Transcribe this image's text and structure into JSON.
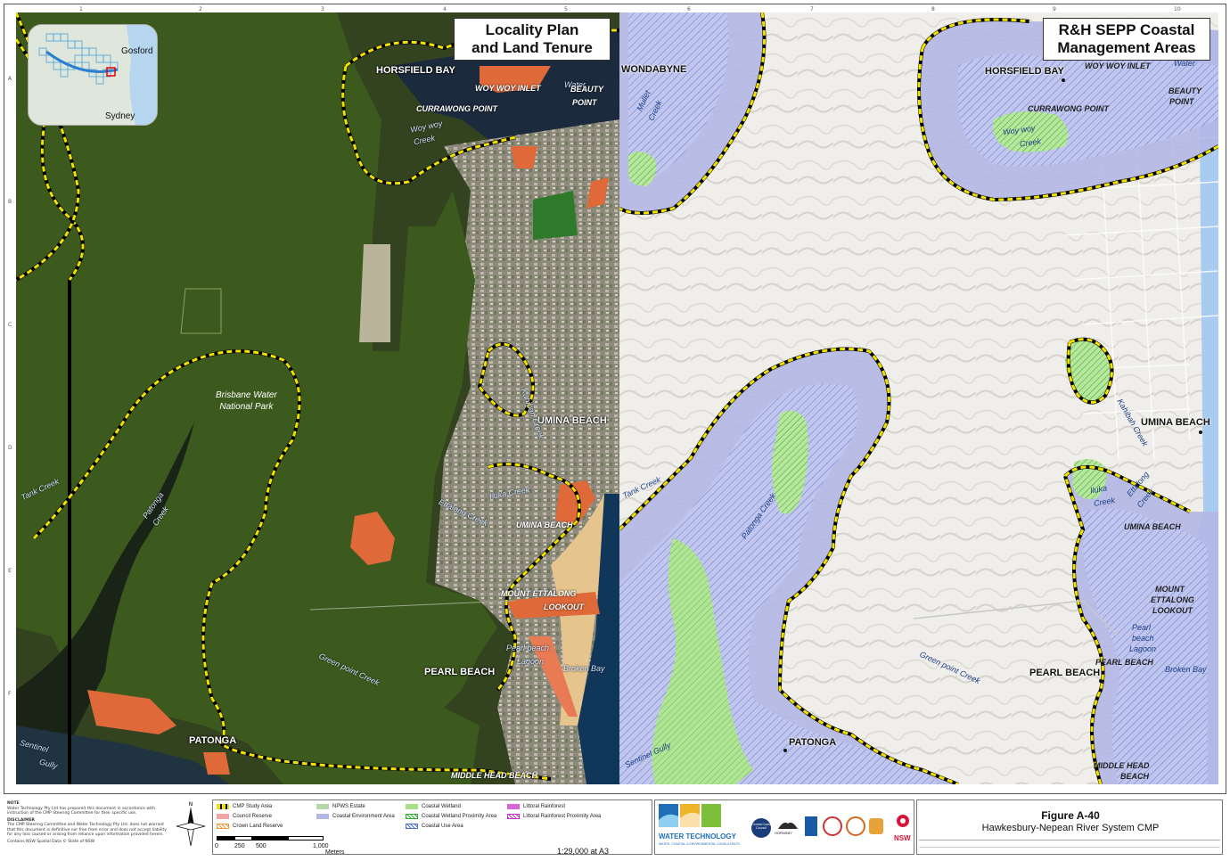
{
  "left_panel": {
    "title_line1": "Locality Plan",
    "title_line2": "and Land Tenure",
    "labels": {
      "horsfield_bay": "HORSFIELD BAY",
      "woy_woy_inlet": "WOY WOY INLET",
      "water": "Water",
      "beauty_point_1": "BEAUTY",
      "beauty_point_2": "POINT",
      "currawong_point": "CURRAWONG POINT",
      "woy_woy_creek_1": "Woy woy",
      "woy_woy_creek_2": "Creek",
      "brisbane_water_1": "Brisbane Water",
      "brisbane_water_2": "National Park",
      "umina_beach_1": "UMINA BEACH",
      "umina_beach_2": "UMINA BEACH",
      "kahibah_creek": "Kahibah Creek",
      "iluka_creek": "Iluka Creek",
      "ettalong_creek": "Ettalong Creek",
      "tank_creek": "Tank Creek",
      "patonga_creek_1": "Patonga",
      "patonga_creek_2": "Creek",
      "mount_ettalong_1": "MOUNT ETTALONG",
      "mount_ettalong_2": "LOOKOUT",
      "pearl_beach": "PEARL BEACH",
      "pearl_beach_lagoon_1": "Pearl beach",
      "pearl_beach_lagoon_2": "Lagoon",
      "broken_bay": "Broken Bay",
      "green_point_creek": "Green point Creek",
      "patonga": "PATONGA",
      "sentinel_gully_1": "Sentinel",
      "sentinel_gully_2": "Gully",
      "middle_head_beach": "MIDDLE HEAD BEACH",
      "wondabyne": "WONDABYNE"
    },
    "inset": {
      "gosford": "Gosford",
      "sydney": "Sydney"
    }
  },
  "right_panel": {
    "title_line1": "R&H SEPP Coastal",
    "title_line2": "Management Areas",
    "labels": {
      "horsfield_bay": "HORSFIELD BAY",
      "woy_woy_inlet": "WOY WOY INLET",
      "water": "Water",
      "beauty_1": "BEAUTY",
      "beauty_2": "POINT",
      "currawong_point": "CURRAWONG POINT",
      "woy_woy_1": "Woy woy",
      "woy_woy_2": "Creek",
      "mullet_1": "Mullet",
      "mullet_2": "Creek",
      "umina_beach": "UMINA BEACH",
      "umina_beach_2": "UMINA BEACH",
      "kahibah_creek": "Kahibah Creek",
      "iluka_1": "Iluka",
      "iluka_2": "Creek",
      "ettalong_1": "Ettalong",
      "ettalong_2": "Creek",
      "tank_creek": "Tank Creek",
      "patonga_creek": "Patonga Creek",
      "mount_1": "MOUNT",
      "mount_2": "ETTALONG",
      "mount_3": "LOOKOUT",
      "pearl_beach": "PEARL BEACH",
      "pearl_beach_2": "PEARL BEACH",
      "pearl_lagoon_1": "Pearl",
      "pearl_lagoon_2": "beach",
      "pearl_lagoon_3": "Lagoon",
      "broken_bay": "Broken Bay",
      "green_point_creek": "Green point Creek",
      "patonga": "PATONGA",
      "sentinel_gully": "Sentinel Gully",
      "middle_head_1": "MIDDLE HEAD",
      "middle_head_2": "BEACH"
    }
  },
  "footer": {
    "note_heading": "NOTE",
    "note_text": "Water Technology Pty Ltd has prepared this document in accordance with instruction of the CMP Steering Committee for their specific use.",
    "disclaimer_heading": "DISCLAIMER",
    "disclaimer_text": "The CMP Steering Committee and Water Technology Pty Ltd. does not warrant that this document is definitive nor free from error and does not accept liability for any loss caused or arising from reliance upon information provided herein.",
    "contains_text": "Contains NSW Spatial Data © State of NSW",
    "legend": [
      {
        "label": "CMP Study Area",
        "color": "#f2e200",
        "style": "dash"
      },
      {
        "label": "Council Reserve",
        "color": "#f2a3a3",
        "style": "fill"
      },
      {
        "label": "Crown Land Reserve",
        "color": "#e89a3a",
        "style": "hatch"
      },
      {
        "label": "NPWS Estate",
        "color": "#b6d7a8",
        "style": "fill"
      },
      {
        "label": "Coastal Environment Area",
        "color": "#b3b7e6",
        "style": "fill"
      },
      {
        "label": "Coastal Wetland",
        "color": "#a8e08a",
        "style": "fill"
      },
      {
        "label": "Coastal Wetland Proximity Area",
        "color": "#2ea82e",
        "style": "hatch"
      },
      {
        "label": "Coastal Use Area",
        "color": "#4a6fd6",
        "style": "hatch"
      },
      {
        "label": "Littoral Rainforest",
        "color": "#d966d9",
        "style": "fill"
      },
      {
        "label": "Littoral Rainforest Proximity Area",
        "color": "#c22ec2",
        "style": "hatch"
      }
    ],
    "scale_ticks": [
      "0",
      "250",
      "500",
      "1,000"
    ],
    "scale_unit": "Meters",
    "scale_ratio": "1:29,000 at A3",
    "logo_text_1": "WATER TECHNOLOGY",
    "logo_text_2": "WATER, COASTAL & ENVIRONMENTAL CONSULTANTS",
    "figure_title": "Figure A-40",
    "figure_subtitle": "Hawkesbury-Nepean River System CMP",
    "central_coast": "Central Coast Council",
    "hornsby": "HORNSBY",
    "nsw": "NSW"
  },
  "ruler": {
    "top": [
      "1",
      "2",
      "3",
      "4",
      "5",
      "6",
      "7",
      "8",
      "9",
      "10"
    ],
    "side": [
      "A",
      "B",
      "C",
      "D",
      "E",
      "F"
    ]
  },
  "colors": {
    "npws_green": "#3d5a1e",
    "study_area": "#f2e200",
    "council_reserve": "#e0693a",
    "coastal_env": "#b3b7e6",
    "coastal_use": "#4a6fd6",
    "wetland": "#a8e08a",
    "water_dark": "#1b2a3c",
    "sea_right": "#a9cbf0"
  }
}
